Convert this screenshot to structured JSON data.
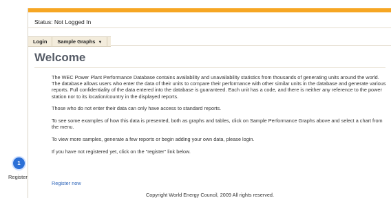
{
  "status": "Status: Not Logged In",
  "menu": {
    "login": "Login",
    "sample_graphs": "Sample Graphs"
  },
  "page_title": "Welcome",
  "paragraphs": [
    "The WEC Power Plant Performance Database contains availability and unavailability statistics from thousands of generating units around the world. The database allows users who enter the data of their units to compare their performance with other similar units in the database and generate various reports. Full confidentiality of the data entered into the database is guaranteed. Each unit has a code, and there is neither any reference to the power station nor to its location/country in the displayed reports.",
    "Those who do not enter their data can only have access to standard reports.",
    "To see some examples of how this data is presented, both as graphs and tables, click on Sample Performance Graphs above and select a chart from the menu.",
    "To view more samples, generate a few reports or begin adding your own data, please login.",
    "If you have not registered yet, click on the \"register\" link below."
  ],
  "register_link": "Register now",
  "copyright": "Copyright World Energy Council, 2009 All rights reserved.",
  "callout": {
    "number": "1",
    "label": "Register"
  },
  "colors": {
    "top_bar": "#f6a623",
    "link": "#2a62b8",
    "callout": "#2b6fd6"
  }
}
